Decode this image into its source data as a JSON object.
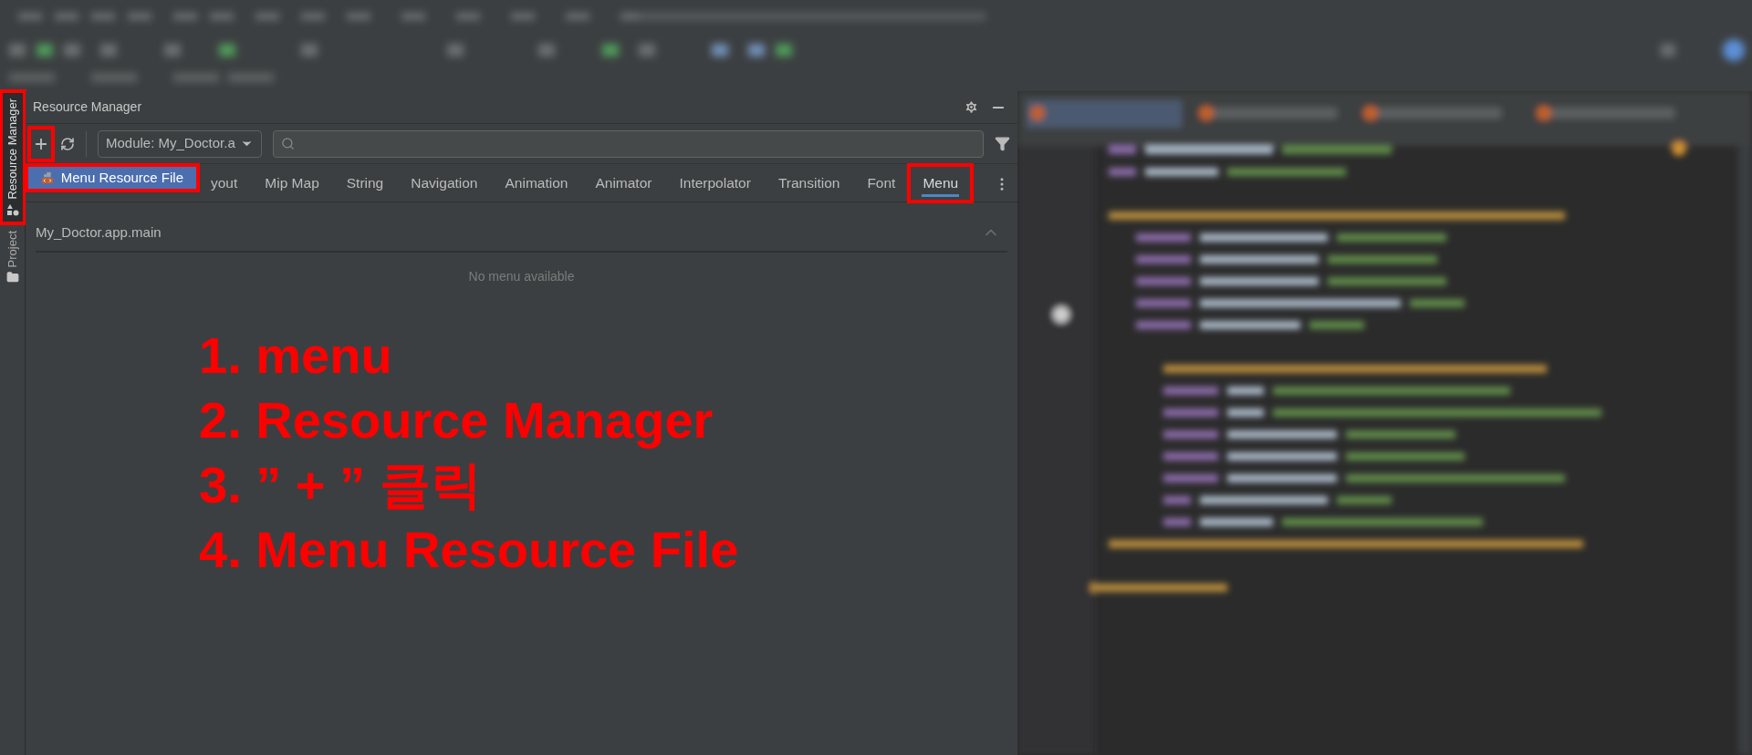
{
  "side_tabs": [
    {
      "label": "Resource Manager",
      "selected": true,
      "highlighted": true
    },
    {
      "label": "Project",
      "selected": false,
      "highlighted": false
    }
  ],
  "panel": {
    "title": "Resource Manager"
  },
  "toolbar": {
    "add_highlighted": true,
    "module": "Module: My_Doctor.a"
  },
  "popup": {
    "items": [
      {
        "label": "Menu Resource File",
        "selected": true,
        "highlighted": true
      }
    ]
  },
  "tabs": [
    {
      "label": "yout",
      "selected": false,
      "highlighted": false
    },
    {
      "label": "Mip Map",
      "selected": false,
      "highlighted": false
    },
    {
      "label": "String",
      "selected": false,
      "highlighted": false
    },
    {
      "label": "Navigation",
      "selected": false,
      "highlighted": false
    },
    {
      "label": "Animation",
      "selected": false,
      "highlighted": false
    },
    {
      "label": "Animator",
      "selected": false,
      "highlighted": false
    },
    {
      "label": "Interpolator",
      "selected": false,
      "highlighted": false
    },
    {
      "label": "Transition",
      "selected": false,
      "highlighted": false
    },
    {
      "label": "Font",
      "selected": false,
      "highlighted": false
    },
    {
      "label": "Menu",
      "selected": true,
      "highlighted": true
    }
  ],
  "section": {
    "title": "My_Doctor.app.main",
    "expanded": true,
    "empty_message": "No menu available"
  },
  "annotations": [
    "1. menu",
    "2. Resource Manager",
    "3. ” + ” 클릭",
    "4. Menu Resource File"
  ]
}
